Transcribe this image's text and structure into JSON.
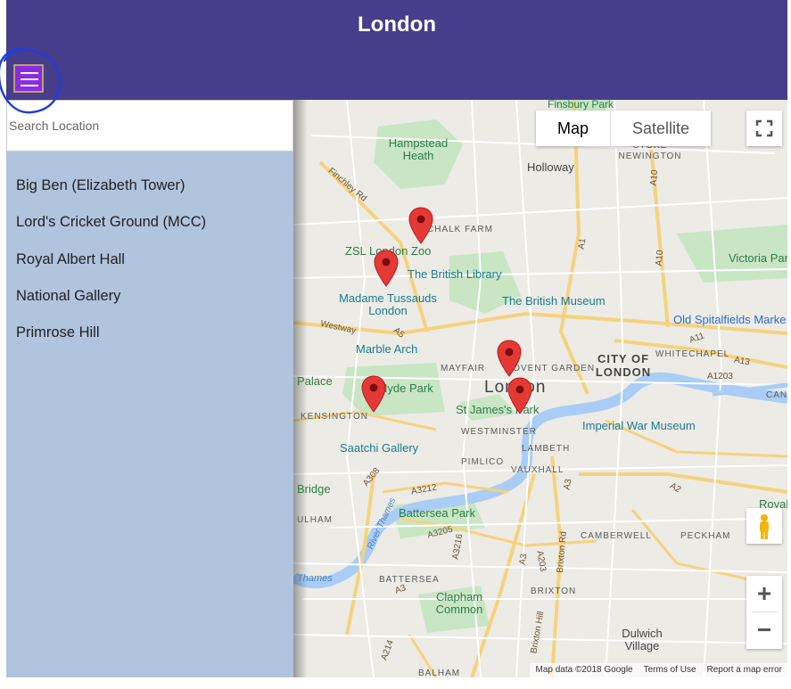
{
  "header": {
    "title": "London"
  },
  "search": {
    "placeholder": "Search Location"
  },
  "locations": [
    "Big Ben (Elizabeth Tower)",
    "Lord's Cricket Ground (MCC)",
    "Royal Albert Hall",
    "National Gallery",
    "Primrose Hill"
  ],
  "map": {
    "type_map": "Map",
    "type_satellite": "Satellite",
    "labels": {
      "finsbury_park": "Finsbury Park",
      "hampstead_heath": "Hampstead Heath",
      "holloway": "Holloway",
      "stoke_newington": "STOKE NEWINGTON",
      "chalk_farm": "CHALK FARM",
      "zsl_zoo": "ZSL London Zoo",
      "british_library": "The British Library",
      "victoria_park": "Victoria Par",
      "madame_tussauds": "Madame Tussauds London",
      "british_museum": "The British Museum",
      "old_spitalfields": "Old Spitalfields Marke",
      "westway": "Westway",
      "marble_arch": "Marble Arch",
      "city_of_london": "CITY OF LONDON",
      "whitechapel": "WHITECHAPEL",
      "mayfair": "MAYFAIR",
      "covent_garden": "COVENT GARDEN",
      "palace": "Palace",
      "hyde_park": "Hyde Park",
      "london": "London",
      "kensington": "KENSINGTON",
      "st_james": "St James's Park",
      "imperial_war_museum": "Imperial War Museum",
      "westminster": "WESTMINSTER",
      "lambeth": "LAMBETH",
      "saatchi": "Saatchi Gallery",
      "pimlico": "PIMLICO",
      "vauxhall": "VAUXHALL",
      "bridge": "Bridge",
      "battersea_park": "Battersea Park",
      "camberwell": "CAMBERWELL",
      "peckham": "PECKHAM",
      "royal": "Royal",
      "fulham": "ULHAM",
      "thames": "Thames",
      "river_thames": "River Thames",
      "battersea": "BATTERSEA",
      "brixton": "BRIXTON",
      "clapham_common": "Clapham Common",
      "dulwich_village": "Dulwich Village",
      "balham": "BALHAM",
      "canal": "CANA",
      "finchley_rd": "Finchley Rd",
      "a1": "A1",
      "a10": "A10",
      "a11": "A11",
      "a13": "A13",
      "a1203": "A1203",
      "a5": "A5",
      "a3": "A3",
      "a2": "A2",
      "a308": "A308",
      "a3212": "A3212",
      "a3205": "A3205",
      "a3216": "A3216",
      "a203": "A203",
      "a214": "A214",
      "brixton_rd": "Brixton Rd",
      "brixton_hill": "Brixton Hill"
    },
    "zoom_in": "+",
    "zoom_out": "−",
    "footer": {
      "attribution": "Map data ©2018 Google",
      "terms": "Terms of Use",
      "report": "Report a map error"
    }
  },
  "colors": {
    "header": "#483D8B",
    "hamburger": "#8A2BE2",
    "sidebar": "#B0C4DE",
    "marker": "#E53935",
    "annotation": "#1f3fd6"
  }
}
